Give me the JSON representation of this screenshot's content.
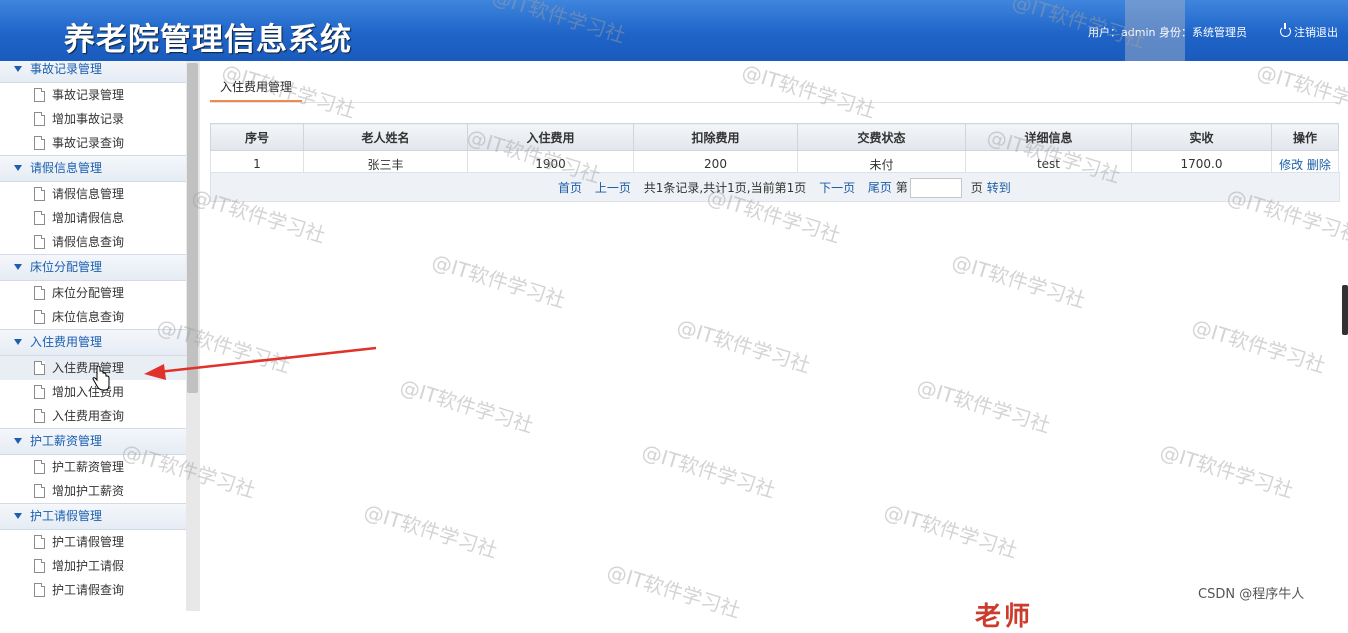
{
  "header": {
    "title": "养老院管理信息系统",
    "user_info": "用户：admin 身份：系统管理员",
    "logout": "注销退出"
  },
  "sidebar": {
    "groups": [
      {
        "title": "事故记录管理",
        "items": [
          "事故记录管理",
          "增加事故记录",
          "事故记录查询"
        ]
      },
      {
        "title": "请假信息管理",
        "items": [
          "请假信息管理",
          "增加请假信息",
          "请假信息查询"
        ]
      },
      {
        "title": "床位分配管理",
        "items": [
          "床位分配管理",
          "床位信息查询"
        ]
      },
      {
        "title": "入住费用管理",
        "items": [
          "入住费用管理",
          "增加入住费用",
          "入住费用查询"
        ]
      },
      {
        "title": "护工薪资管理",
        "items": [
          "护工薪资管理",
          "增加护工薪资"
        ]
      },
      {
        "title": "护工请假管理",
        "items": [
          "护工请假管理",
          "增加护工请假",
          "护工请假查询"
        ]
      }
    ]
  },
  "tab": {
    "label": "入住费用管理"
  },
  "table": {
    "headers": [
      "序号",
      "老人姓名",
      "入住费用",
      "扣除费用",
      "交费状态",
      "详细信息",
      "实收",
      "操作"
    ],
    "rows": [
      {
        "id": "1",
        "name": "张三丰",
        "fee": "1900",
        "deduct": "200",
        "status": "未付",
        "detail": "test",
        "actual": "1700.0",
        "edit": "修改",
        "delete": "删除"
      }
    ]
  },
  "pager": {
    "first": "首页",
    "prev": "上一页",
    "summary": "共1条记录,共计1页,当前第1页",
    "next": "下一页",
    "last": "尾页",
    "page_prefix": "第",
    "page_suffix": "页",
    "go": "转到"
  },
  "watermark": "@IT软件学习社",
  "footer": {
    "csdn": "CSDN @程序牛人",
    "bottom_text": "老师"
  }
}
